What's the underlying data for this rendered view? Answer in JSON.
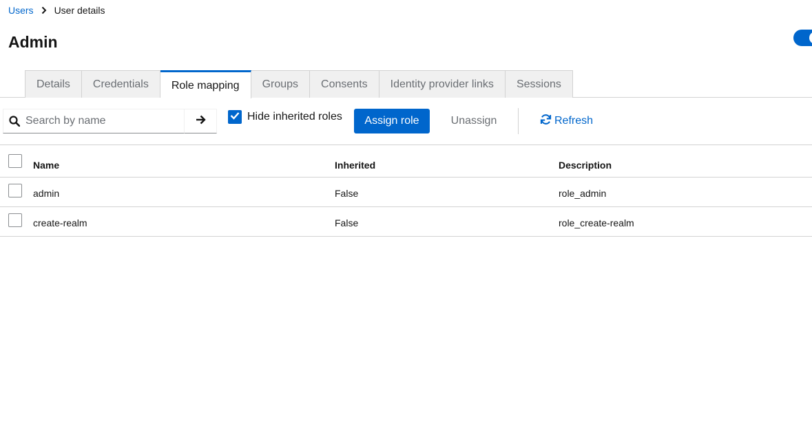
{
  "breadcrumb": {
    "parent": "Users",
    "current": "User details"
  },
  "page": {
    "title": "Admin",
    "enabled_toggle": true
  },
  "tabs": [
    {
      "label": "Details",
      "active": false
    },
    {
      "label": "Credentials",
      "active": false
    },
    {
      "label": "Role mapping",
      "active": true
    },
    {
      "label": "Groups",
      "active": false
    },
    {
      "label": "Consents",
      "active": false
    },
    {
      "label": "Identity provider links",
      "active": false
    },
    {
      "label": "Sessions",
      "active": false
    }
  ],
  "toolbar": {
    "search_placeholder": "Search by name",
    "search_value": "",
    "hide_inherited_label": "Hide inherited roles",
    "hide_inherited_checked": true,
    "assign_label": "Assign role",
    "unassign_label": "Unassign",
    "refresh_label": "Refresh"
  },
  "table": {
    "columns": [
      "Name",
      "Inherited",
      "Description"
    ],
    "rows": [
      {
        "name": "admin",
        "inherited": "False",
        "description": "role_admin"
      },
      {
        "name": "create-realm",
        "inherited": "False",
        "description": "role_create-realm"
      }
    ]
  },
  "colors": {
    "accent": "#0066cc",
    "text": "#151515",
    "muted": "#6a6e73",
    "border": "#d2d2d2"
  },
  "icons": {
    "breadcrumb_separator": "chevron-right-icon",
    "search": "search-icon",
    "search_submit": "arrow-right-icon",
    "checkbox": "check-icon",
    "refresh": "sync-icon"
  }
}
